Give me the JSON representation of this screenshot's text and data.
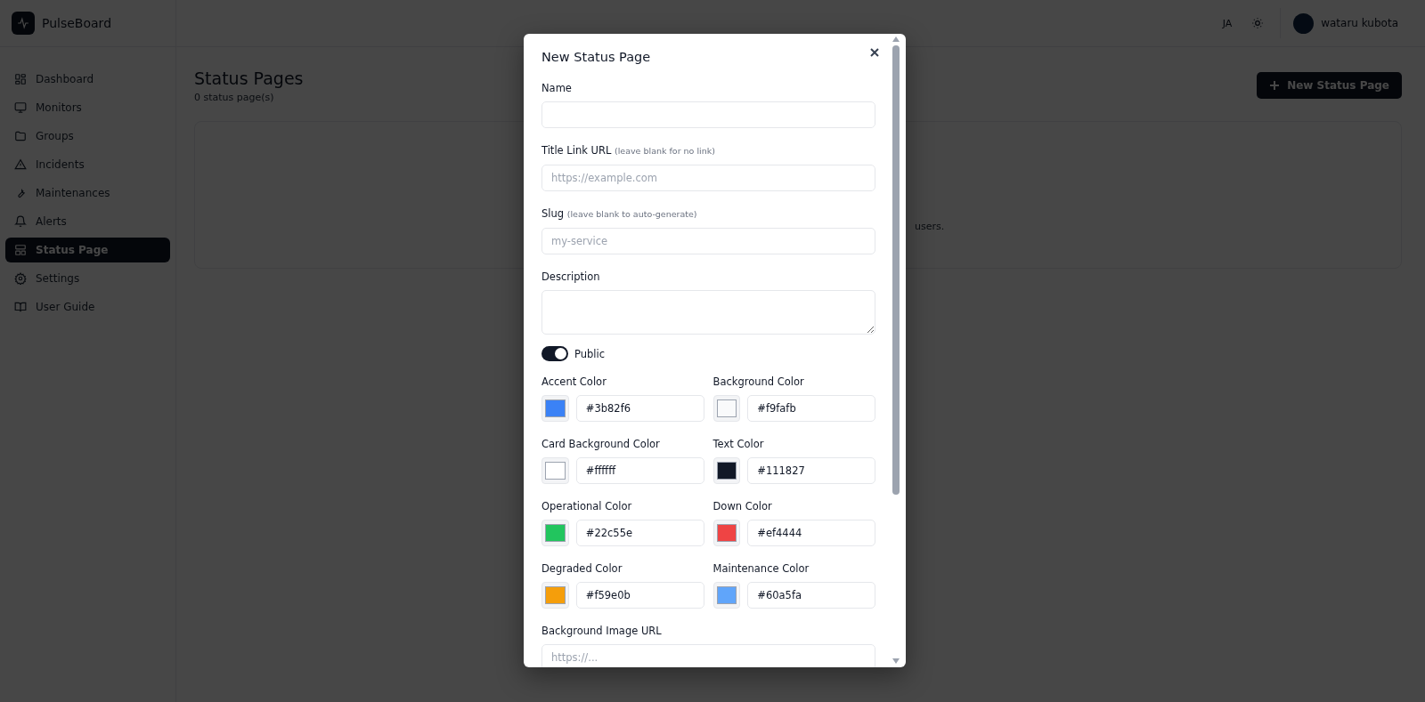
{
  "app": {
    "name": "PulseBoard"
  },
  "sidebar": {
    "items": [
      {
        "label": "Dashboard",
        "selected": false
      },
      {
        "label": "Monitors",
        "selected": false
      },
      {
        "label": "Groups",
        "selected": false
      },
      {
        "label": "Incidents",
        "selected": false
      },
      {
        "label": "Maintenances",
        "selected": false
      },
      {
        "label": "Alerts",
        "selected": false
      },
      {
        "label": "Status Page",
        "selected": true
      },
      {
        "label": "Settings",
        "selected": false
      },
      {
        "label": "User Guide",
        "selected": false
      }
    ]
  },
  "header": {
    "language": "JA",
    "user": "wataru kubota"
  },
  "page": {
    "title": "Status Pages",
    "count": "0 status page(s)",
    "new_button": "New Status Page",
    "empty_text": "users."
  },
  "dialog": {
    "title": "New Status Page",
    "fields": [
      {
        "label": "Name",
        "kind": "input"
      },
      {
        "label": "Title Link URL",
        "hint": "(leave blank for no link)",
        "placeholder": "https://example.com",
        "kind": "input"
      },
      {
        "label": "Slug",
        "hint": "(leave blank to auto-generate)",
        "placeholder": "my-service",
        "kind": "input"
      },
      {
        "label": "Description",
        "kind": "textarea"
      }
    ],
    "public_toggle": {
      "label": "Public",
      "on": true
    },
    "colors": [
      {
        "label": "Accent Color",
        "value": "#3b82f6",
        "color": "#3b82f6"
      },
      {
        "label": "Background Color",
        "value": "#f9fafb",
        "color": "#f9fafb"
      },
      {
        "label": "Card Background Color",
        "value": "#ffffff",
        "color": "#ffffff"
      },
      {
        "label": "Text Color",
        "value": "#111827",
        "color": "#111827"
      },
      {
        "label": "Operational Color",
        "value": "#22c55e",
        "color": "#22c55e"
      },
      {
        "label": "Down Color",
        "value": "#ef4444",
        "color": "#ef4444"
      },
      {
        "label": "Degraded Color",
        "value": "#f59e0b",
        "color": "#f59e0b"
      },
      {
        "label": "Maintenance Color",
        "value": "#60a5fa",
        "color": "#60a5fa"
      }
    ],
    "bg_image": {
      "label": "Background Image URL",
      "placeholder": "https://..."
    }
  }
}
